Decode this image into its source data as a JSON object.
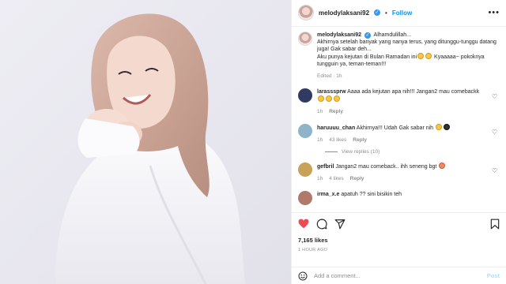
{
  "post": {
    "author": "melodylaksani92",
    "follow_label": "Follow",
    "dot": "•",
    "more_label": "•••"
  },
  "caption": {
    "username": "melodylaksani92",
    "text": "Alhamdulillah...\nAkhirnya setelah banyak yang nanya terus, yang ditunggu-tunggu datang juga! Gak sabar deh...\nAku punya kejutan di Bulan Ramadan ini",
    "text_tail": " Kyaaaaa~ pokoknya tungguin ya, teman-teman!!!",
    "edited": "Edited · 1h"
  },
  "comments": [
    {
      "username": "larasssprw",
      "text": "Aaaa ada kejutan apa nih!!! Jangan2 mau comebackk",
      "time": "1h",
      "likes": "",
      "reply": "Reply",
      "avatar_color": "#2f3b63"
    },
    {
      "username": "haruuuu_chan",
      "text": "Akhirnya!!! Udah Gak sabar nih",
      "time": "1h",
      "likes": "43 likes",
      "reply": "Reply",
      "avatar_color": "#8fb3c9",
      "view_replies": "View replies (10)"
    },
    {
      "username": "gefbril",
      "text": "Jangan2 mau comeback.. ihh seneng bgt",
      "time": "1h",
      "likes": "4 likes",
      "reply": "Reply",
      "avatar_color": "#c9a25a"
    },
    {
      "username": "irma_x.e",
      "text": "apatuh ?? sini bisikin teh",
      "time": "",
      "likes": "",
      "reply": "",
      "avatar_color": "#b07a6a"
    }
  ],
  "stats": {
    "likes": "7,165 likes",
    "time_ago": "1 HOUR AGO"
  },
  "add_comment": {
    "placeholder": "Add a comment...",
    "post_label": "Post"
  },
  "colors": {
    "link_blue": "#0095f6",
    "verified_blue": "#3897f0",
    "like_red": "#ed4956",
    "secondary_text": "#8e8e8e"
  },
  "icons": [
    "heart-icon",
    "comment-icon",
    "share-icon",
    "bookmark-icon",
    "emoji-icon",
    "more-icon",
    "verified-icon"
  ]
}
